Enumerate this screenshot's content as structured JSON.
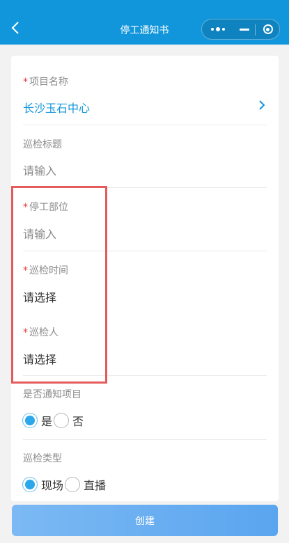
{
  "header": {
    "title": "停工通知书",
    "bar_color": "#1296db"
  },
  "form": {
    "required_mark": "*",
    "project": {
      "label": "项目名称",
      "value": "长沙玉石中心"
    },
    "inspection_title": {
      "label": "巡检标题",
      "placeholder": "请输入"
    },
    "stop_location": {
      "label": "停工部位",
      "placeholder": "请输入"
    },
    "inspection_time": {
      "label": "巡检时间",
      "placeholder": "请选择"
    },
    "inspector": {
      "label": "巡检人",
      "placeholder": "请选择"
    },
    "notify_project": {
      "label": "是否通知项目",
      "options": [
        {
          "label": "是",
          "checked": true
        },
        {
          "label": "否",
          "checked": false
        }
      ]
    },
    "inspection_type": {
      "label": "巡检类型",
      "options": [
        {
          "label": "现场",
          "checked": true
        },
        {
          "label": "直播",
          "checked": false
        }
      ]
    }
  },
  "actions": {
    "create_label": "创建"
  },
  "colors": {
    "accent": "#1296db",
    "required": "#e33b3b",
    "highlight_box": "#e45b5b"
  }
}
